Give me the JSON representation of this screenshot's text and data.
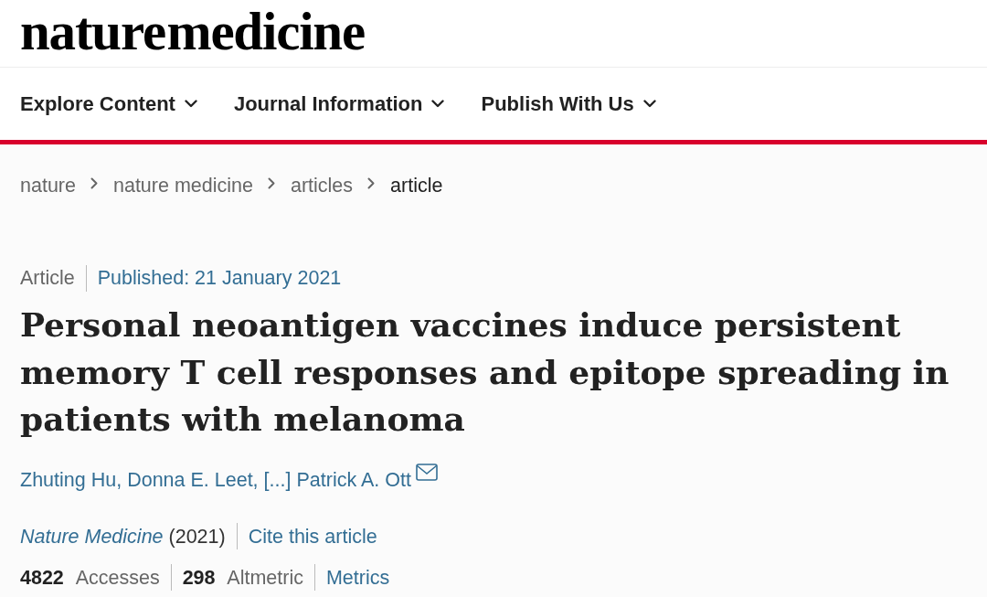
{
  "logo": {
    "text": "nature medicine"
  },
  "nav": [
    {
      "label": "Explore Content"
    },
    {
      "label": "Journal Information"
    },
    {
      "label": "Publish With Us"
    }
  ],
  "breadcrumbs": [
    {
      "label": "nature",
      "current": false
    },
    {
      "label": "nature medicine",
      "current": false
    },
    {
      "label": "articles",
      "current": false
    },
    {
      "label": "article",
      "current": true
    }
  ],
  "article": {
    "type": "Article",
    "published": "Published: 21 January 2021",
    "title": "Personal neoantigen vaccines induce persistent memory T cell responses and epitope spreading in patients with melanoma",
    "authors": [
      {
        "name": "Zhuting Hu,",
        "corresponding": false
      },
      {
        "name": "Donna E. Leet,",
        "corresponding": false
      },
      {
        "name": "[...]",
        "corresponding": false
      },
      {
        "name": "Patrick A. Ott",
        "corresponding": true
      }
    ],
    "journal": "Nature Medicine",
    "year": "(2021)",
    "cite": "Cite this article",
    "metrics": [
      "**4822** Accesses",
      "**298** Altmetric"
    ],
    "metrics_link": "Metrics"
  }
}
